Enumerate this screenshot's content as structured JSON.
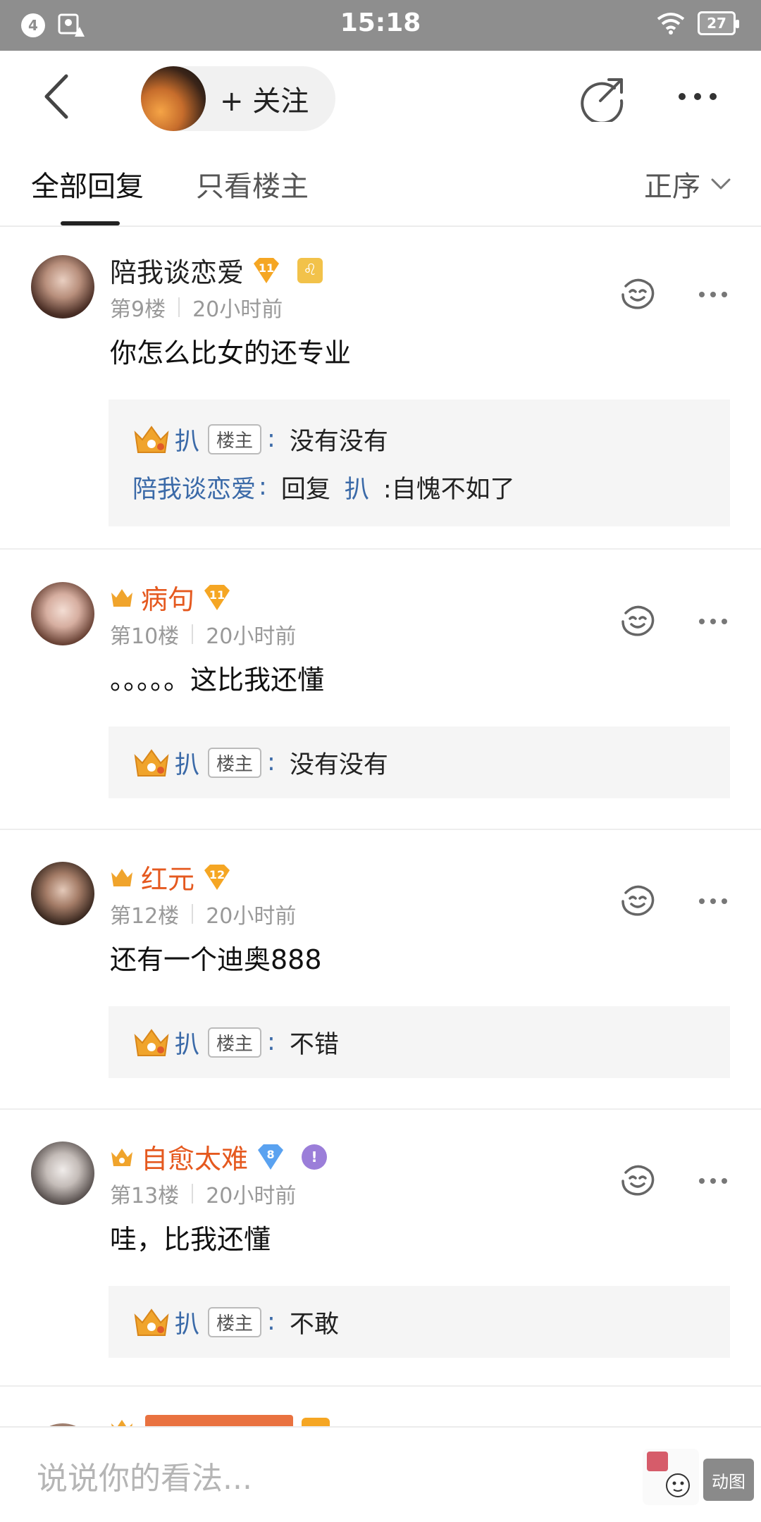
{
  "status_bar": {
    "notifications": "4",
    "time": "15:18",
    "battery": "27"
  },
  "header": {
    "follow_label": "+ 关注"
  },
  "tabs": {
    "all": "全部回复",
    "host_only": "只看楼主",
    "sort": "正序"
  },
  "comments": [
    {
      "username": "陪我谈恋爱",
      "vip": false,
      "level": "11",
      "extra_badge": "♌",
      "floor": "第9楼",
      "time": "20小时前",
      "text": "你怎么比女的还专业",
      "replies": [
        {
          "name": "扒",
          "host_tag": "楼主",
          "colon": ":",
          "text": "没有没有"
        },
        {
          "name": "陪我谈恋爱",
          "colon": ":",
          "prefix": "回复",
          "to": "扒",
          "text": ":自愧不如了"
        }
      ]
    },
    {
      "username": "病句",
      "vip": true,
      "level": "11",
      "floor": "第10楼",
      "time": "20小时前",
      "text": "。。。。。这比我还懂",
      "replies": [
        {
          "name": "扒",
          "host_tag": "楼主",
          "colon": ":",
          "text": "没有没有"
        }
      ]
    },
    {
      "username": "红元",
      "vip": true,
      "level": "12",
      "floor": "第12楼",
      "time": "20小时前",
      "text": "还有一个迪奥888",
      "replies": [
        {
          "name": "扒",
          "host_tag": "楼主",
          "colon": ":",
          "text": "不错"
        }
      ]
    },
    {
      "username": "自愈太难",
      "vip": true,
      "level": "8",
      "extra_badge": "!",
      "floor": "第13楼",
      "time": "20小时前",
      "text": "哇，比我还懂",
      "replies": [
        {
          "name": "扒",
          "host_tag": "楼主",
          "colon": ":",
          "text": "不敢"
        }
      ]
    }
  ],
  "bottom_bar": {
    "placeholder": "说说你的看法...",
    "gif_label": "动图"
  },
  "colors": {
    "vip_name": "#e5591f",
    "reply_name": "#3b6aa8",
    "status_bar": "#8e8e8e",
    "level_badge": "#f5a623",
    "level_badge_blue": "#5aa2f0"
  }
}
